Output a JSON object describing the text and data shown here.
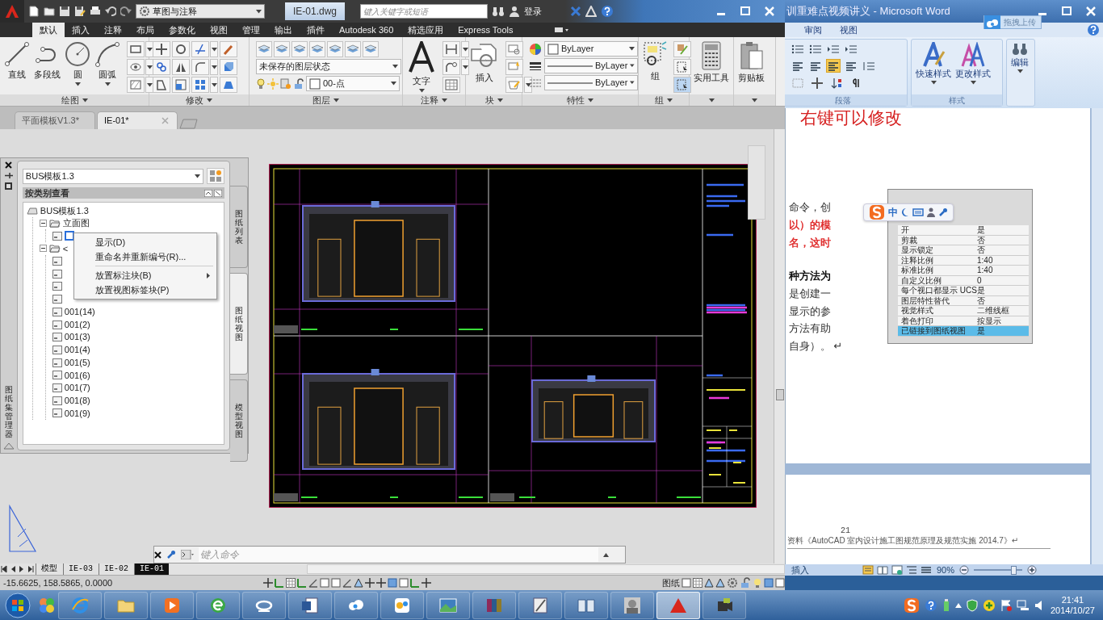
{
  "autocad": {
    "quick_access": {
      "workspace": "草图与注释",
      "file_title": "IE-01.dwg",
      "search_placeholder": "键入关键字或短语",
      "login": "登录"
    },
    "ribbon_tabs": [
      {
        "label": "默认",
        "selected": true
      },
      {
        "label": "插入",
        "selected": false
      },
      {
        "label": "注释",
        "selected": false
      },
      {
        "label": "布局",
        "selected": false
      },
      {
        "label": "参数化",
        "selected": false
      },
      {
        "label": "视图",
        "selected": false
      },
      {
        "label": "管理",
        "selected": false
      },
      {
        "label": "输出",
        "selected": false
      },
      {
        "label": "插件",
        "selected": false
      },
      {
        "label": "Autodesk 360",
        "selected": false
      },
      {
        "label": "精选应用",
        "selected": false
      },
      {
        "label": "Express Tools",
        "selected": false
      }
    ],
    "panels": [
      {
        "kind": "draw",
        "title": "绘图",
        "tools": [
          "直线",
          "多段线",
          "圆",
          "圆弧"
        ]
      },
      {
        "kind": "modify",
        "title": "修改"
      },
      {
        "kind": "layers",
        "title": "图层",
        "layer_state": "未保存的图层状态",
        "layer": "00-点"
      },
      {
        "kind": "annotate",
        "title": "注释",
        "tools": [
          "文字"
        ]
      },
      {
        "kind": "block",
        "title": "块",
        "tools": [
          "插入"
        ]
      },
      {
        "kind": "properties",
        "title": "特性",
        "fields": [
          "ByLayer",
          "ByLayer",
          "ByLayer"
        ]
      },
      {
        "kind": "group",
        "title": "组",
        "tools": [
          "组"
        ]
      },
      {
        "kind": "utility",
        "tools": [
          "实用工具"
        ]
      },
      {
        "kind": "clipboard",
        "tools": [
          "剪贴板"
        ]
      }
    ],
    "doc_tabs": [
      {
        "label": "平面模板V1.3*",
        "selected": false
      },
      {
        "label": "IE-01*",
        "selected": true
      }
    ],
    "sheet_set": {
      "title": "图纸集管理器",
      "dropdown": "BUS模板1.3",
      "header": "按类别查看",
      "tree": [
        {
          "kind": "sheetset",
          "label": "BUS模板1.3",
          "children": [
            {
              "kind": "category",
              "label": "立面图",
              "expanded": true,
              "children": [
                {
                  "kind": "editing"
                }
              ]
            },
            {
              "kind": "category",
              "label": "<",
              "expanded": true,
              "children": [
                {
                  "kind": "sheet"
                },
                {
                  "kind": "sheet"
                },
                {
                  "kind": "sheet"
                },
                {
                  "kind": "sheet"
                },
                {
                  "kind": "sheet",
                  "label": "001(14)"
                },
                {
                  "kind": "sheet",
                  "label": "001(2)"
                },
                {
                  "kind": "sheet",
                  "label": "001(3)"
                },
                {
                  "kind": "sheet",
                  "label": "001(4)"
                },
                {
                  "kind": "sheet",
                  "label": "001(5)"
                },
                {
                  "kind": "sheet",
                  "label": "001(6)"
                },
                {
                  "kind": "sheet",
                  "label": "001(7)"
                },
                {
                  "kind": "sheet",
                  "label": "001(8)"
                },
                {
                  "kind": "sheet",
                  "label": "001(9)"
                }
              ]
            }
          ]
        }
      ],
      "side_tabs": [
        {
          "label": "图纸列表",
          "selected": false
        },
        {
          "label": "图纸视图",
          "selected": true
        },
        {
          "label": "模型视图",
          "selected": false
        }
      ]
    },
    "context_menu": [
      {
        "kind": "item",
        "label": "显示(D)"
      },
      {
        "kind": "item",
        "label": "重命名并重新编号(R)..."
      },
      {
        "kind": "separator"
      },
      {
        "kind": "item",
        "label": "放置标注块(B)",
        "submenu": true
      },
      {
        "kind": "item",
        "label": "放置视图标签块(P)"
      }
    ],
    "command_line": {
      "placeholder": "键入命令"
    },
    "layout_tabs": [
      {
        "label": "模型",
        "selected": false
      },
      {
        "label": "IE-03",
        "selected": false
      },
      {
        "label": "IE-02",
        "selected": false
      },
      {
        "label": "IE-01",
        "selected": true
      }
    ],
    "status_bar": {
      "coordinates": "-15.6625, 158.5865, 0.0000",
      "space": "图纸"
    }
  },
  "word": {
    "title": "训重难点视频讲义 - Microsoft Word",
    "upload": "拖拽上传",
    "tabs": [
      {
        "label": "审阅",
        "selected": false
      },
      {
        "label": "视图",
        "selected": false
      }
    ],
    "alignment": [
      {
        "selected": false
      },
      {
        "selected": false
      },
      {
        "selected": true
      },
      {
        "selected": false
      }
    ],
    "groups": [
      {
        "kind": "paragraph",
        "title": "段落"
      },
      {
        "kind": "styles",
        "title": "样式",
        "tools": [
          "快速样式",
          "更改样式"
        ]
      },
      {
        "kind": "editing",
        "tools": [
          "编辑"
        ]
      }
    ],
    "heading": "右键可以修改",
    "lines": [
      {
        "text": "命令，创",
        "kind": "normal"
      },
      {
        "text": "以）的模",
        "kind": "red"
      },
      {
        "text": "名，这时",
        "kind": "red"
      },
      {
        "text": "种方法为",
        "kind": "bold"
      },
      {
        "text": "是创建一",
        "kind": "normal"
      },
      {
        "text": "显示的参",
        "kind": "normal"
      },
      {
        "text": "方法有助",
        "kind": "normal"
      },
      {
        "text": "自身）。 ↵",
        "kind": "normal"
      }
    ],
    "figure": {
      "rows": [
        {
          "label": "开",
          "value": "是",
          "selected": false
        },
        {
          "label": "剪裁",
          "value": "否",
          "selected": false
        },
        {
          "label": "显示锁定",
          "value": "否",
          "selected": false
        },
        {
          "label": "注释比例",
          "value": "1:40",
          "selected": false
        },
        {
          "label": "标准比例",
          "value": "1:40",
          "selected": false
        },
        {
          "label": "自定义比例",
          "value": "0",
          "selected": false
        },
        {
          "label": "每个视口都显示 UCS",
          "value": "是",
          "selected": false
        },
        {
          "label": "图层特性替代",
          "value": "否",
          "selected": false
        },
        {
          "label": "视觉样式",
          "value": "二维线框",
          "selected": false
        },
        {
          "label": "着色打印",
          "value": "按显示",
          "selected": false
        },
        {
          "label": "已链接到图纸视图",
          "value": "是",
          "selected": true
        }
      ]
    },
    "ime": {
      "mode": "中"
    },
    "page_number": "21",
    "footer": "资料《AutoCAD 室内设计施工图规范原理及规范实施 2014.7》↵",
    "status": {
      "mode": "插入",
      "zoom": "90%"
    },
    "zoom_slider": {
      "level": 0.82
    }
  },
  "taskbar": {
    "buttons": [
      {
        "selected": false
      },
      {
        "selected": false
      },
      {
        "selected": false
      },
      {
        "selected": false
      },
      {
        "selected": false
      },
      {
        "selected": false
      },
      {
        "selected": false
      },
      {
        "selected": false
      },
      {
        "selected": false
      },
      {
        "selected": false
      },
      {
        "selected": false
      },
      {
        "selected": false
      },
      {
        "selected": false
      },
      {
        "selected": true
      },
      {
        "selected": false
      }
    ],
    "time": "21:41",
    "date": "2014/10/27"
  }
}
